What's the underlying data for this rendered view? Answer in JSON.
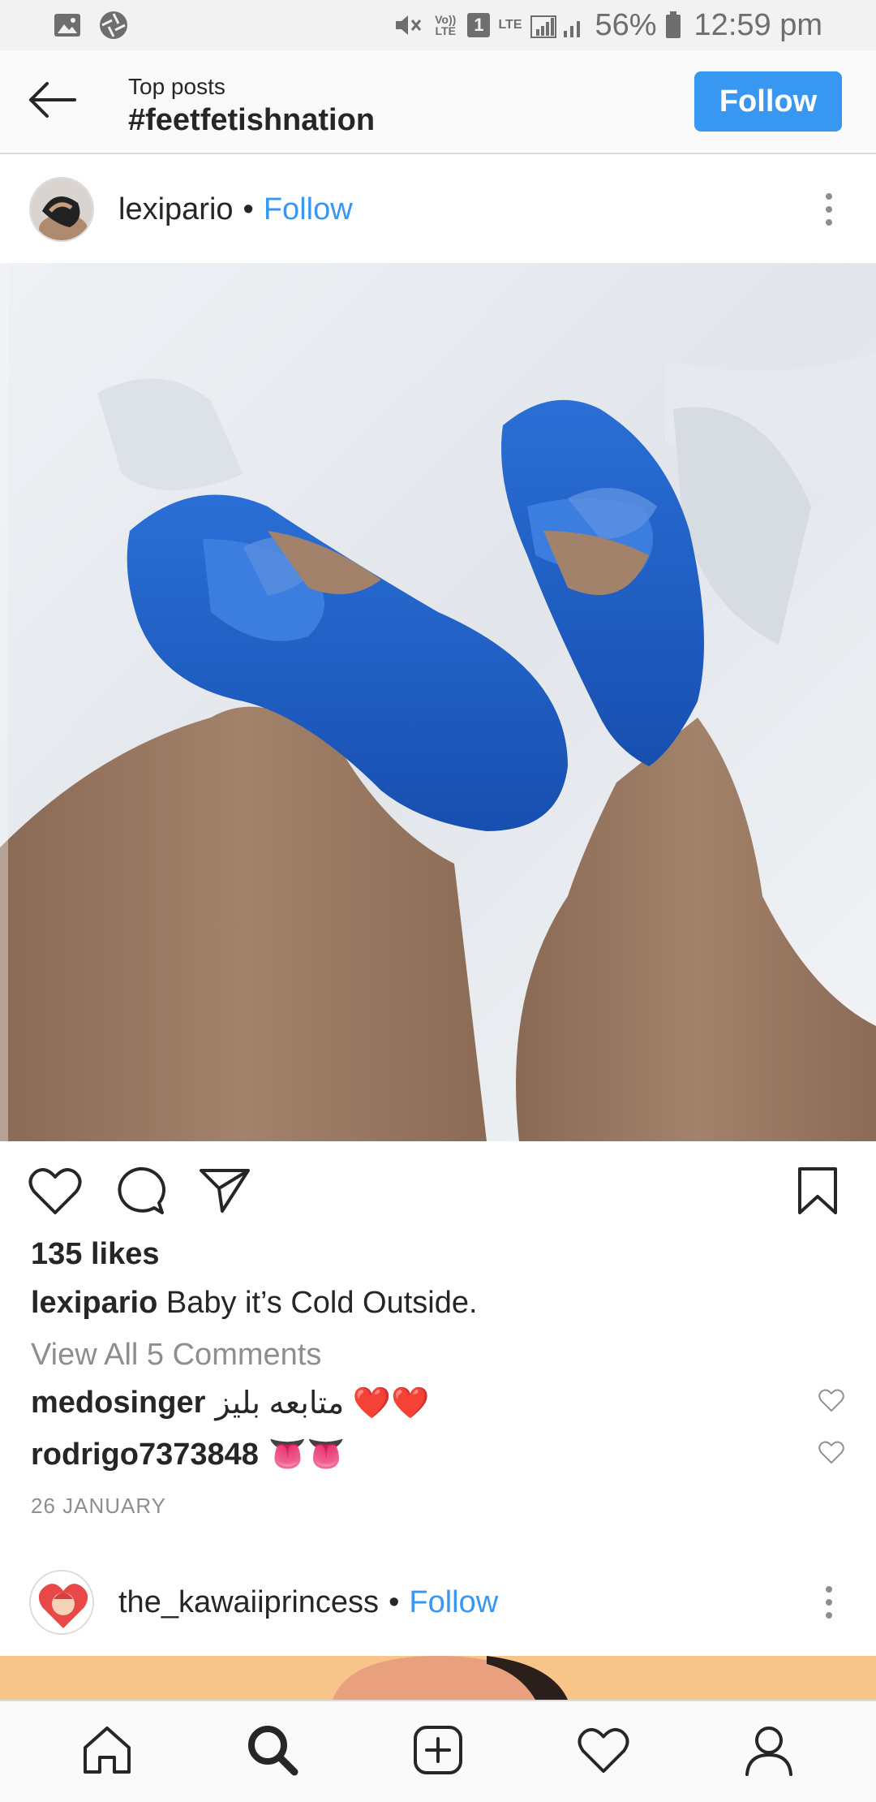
{
  "status_bar": {
    "battery": "56%",
    "time": "12:59 pm",
    "volte": "Vo)) LTE",
    "sim": "1",
    "lte": "LTE"
  },
  "header": {
    "subtitle": "Top posts",
    "title": "#feetfetishnation",
    "follow_label": "Follow",
    "accent_color": "#3897f0"
  },
  "post": {
    "username": "lexipario",
    "separator": "•",
    "follow_label": "Follow",
    "likes": "135 likes",
    "caption_user": "lexipario",
    "caption_text": "Baby it’s Cold Outside.",
    "view_comments": "View All 5 Comments",
    "comments": [
      {
        "user": "medosinger",
        "text": "متابعه بليز ❤️❤️"
      },
      {
        "user": "rodrigo7373848",
        "text": "👅👅"
      }
    ],
    "date": "26 JANUARY"
  },
  "next_post": {
    "username": "the_kawaiiprincess",
    "separator": "•",
    "follow_label": "Follow"
  },
  "icons": {
    "back": "arrow-left-icon",
    "more": "more-vertical-icon",
    "like": "heart-icon",
    "comment": "comment-icon",
    "share": "send-icon",
    "save": "bookmark-icon",
    "nav": [
      "home-icon",
      "search-icon",
      "add-post-icon",
      "activity-heart-icon",
      "profile-icon"
    ]
  }
}
